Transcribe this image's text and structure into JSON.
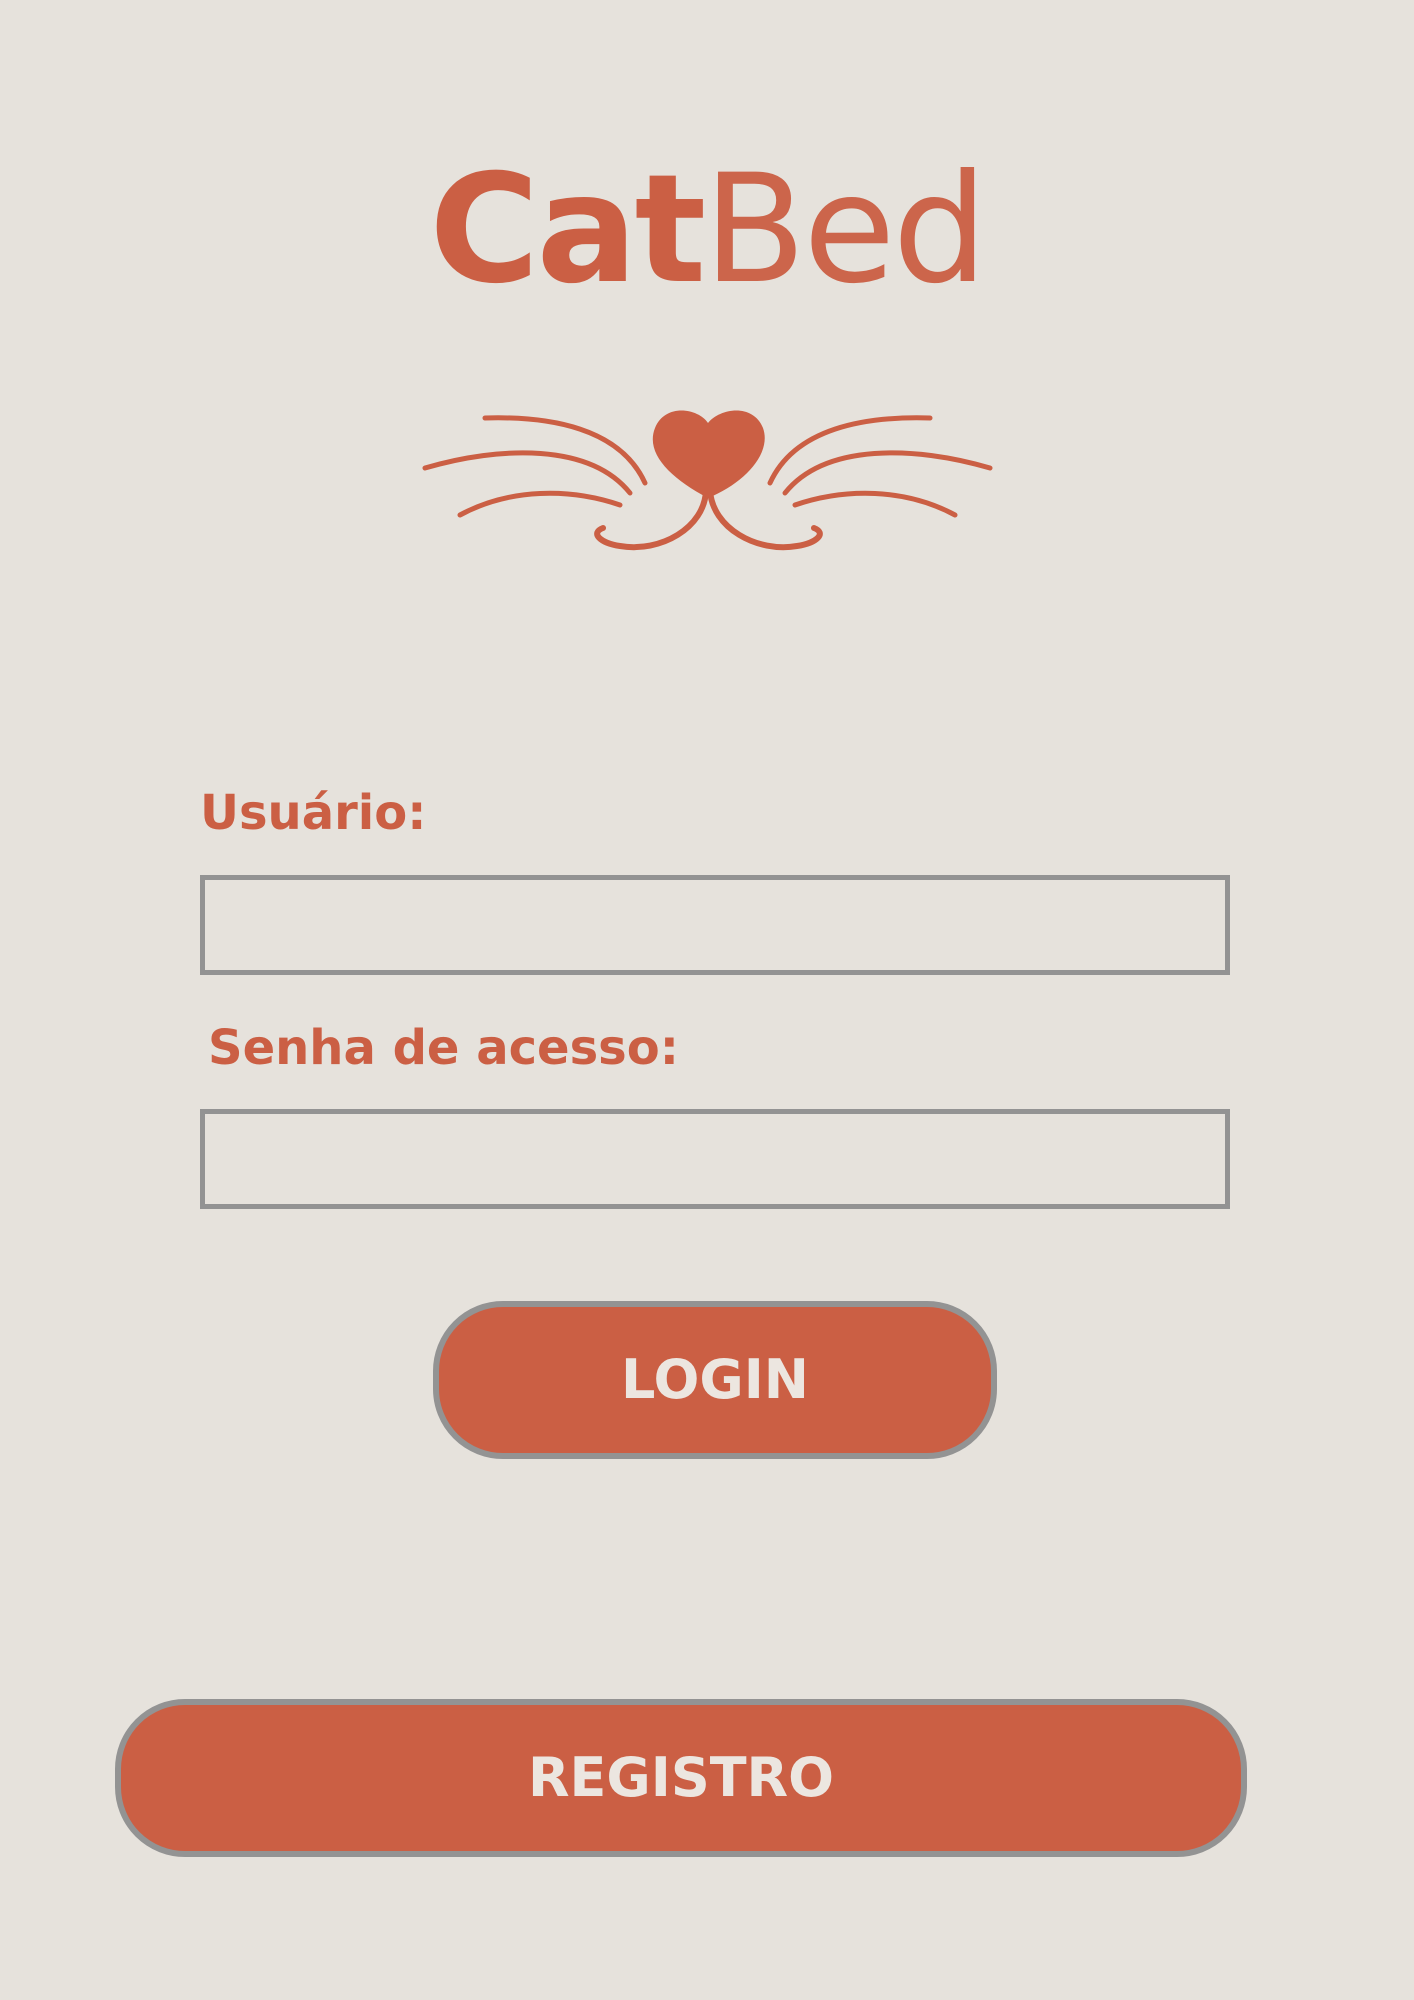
{
  "app": {
    "brand_bold": "Cat",
    "brand_light": "Bed",
    "emblem_icon": "cat-nose-whiskers-icon"
  },
  "form": {
    "username_label": "Usuário:",
    "username_value": "",
    "password_label": "Senha de acesso:",
    "password_value": "",
    "login_label": "LOGIN",
    "register_label": "REGISTRO"
  },
  "colors": {
    "background": "#e6e2dc",
    "accent": "#cb5f44",
    "border": "#939393",
    "button_text": "#ece6e0"
  }
}
